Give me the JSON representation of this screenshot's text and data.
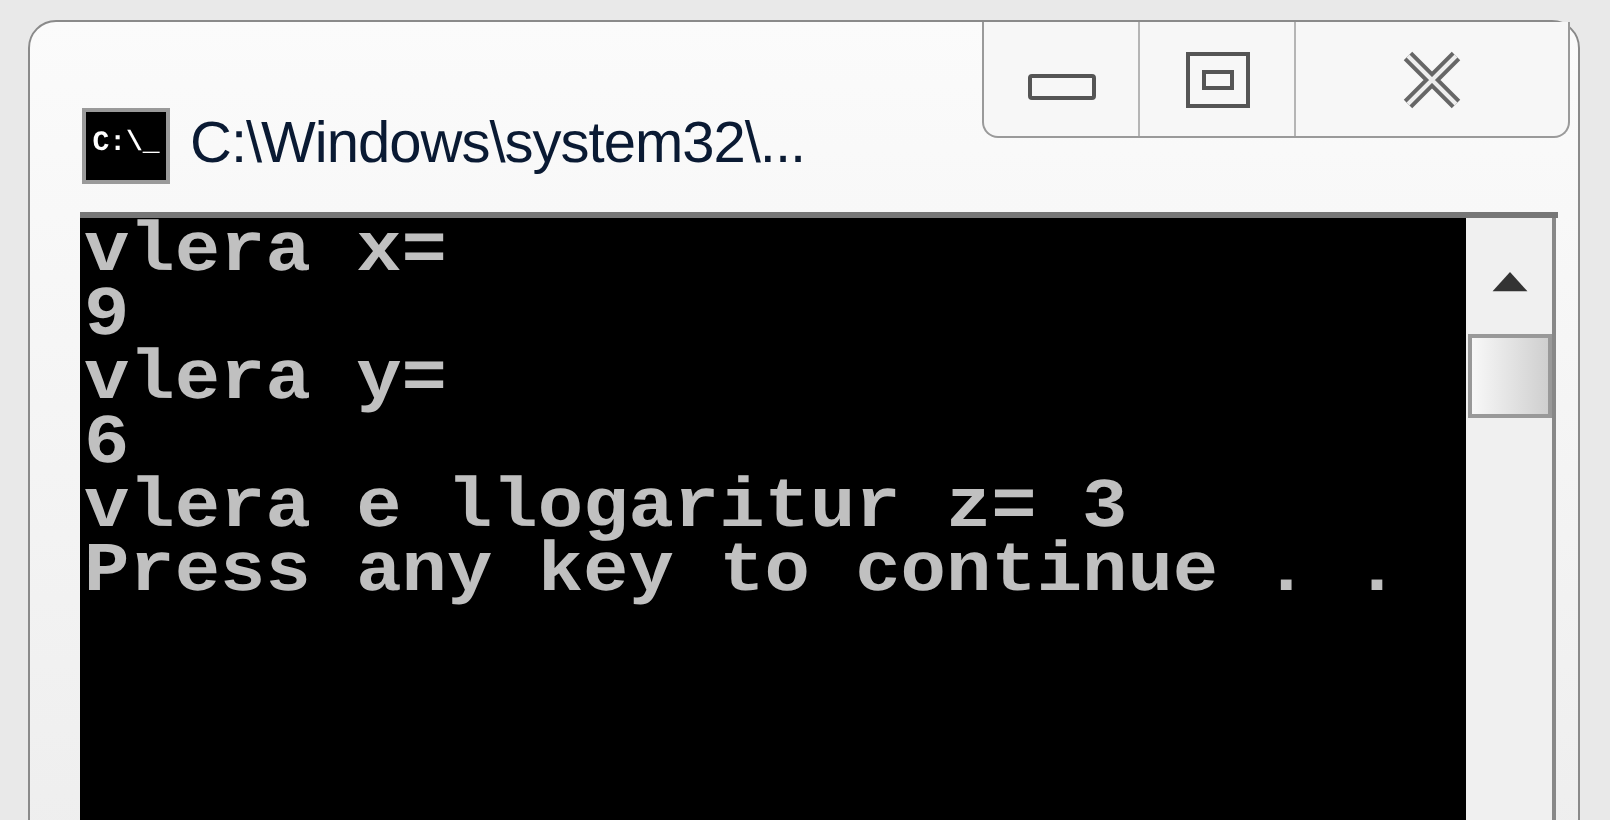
{
  "window": {
    "title": "C:\\Windows\\system32\\...",
    "icon_text": "C:\\_"
  },
  "console": {
    "lines": [
      "vlera x=",
      "9",
      "vlera y=",
      "6",
      "vlera e llogaritur z= 3",
      "Press any key to continue . ."
    ]
  }
}
